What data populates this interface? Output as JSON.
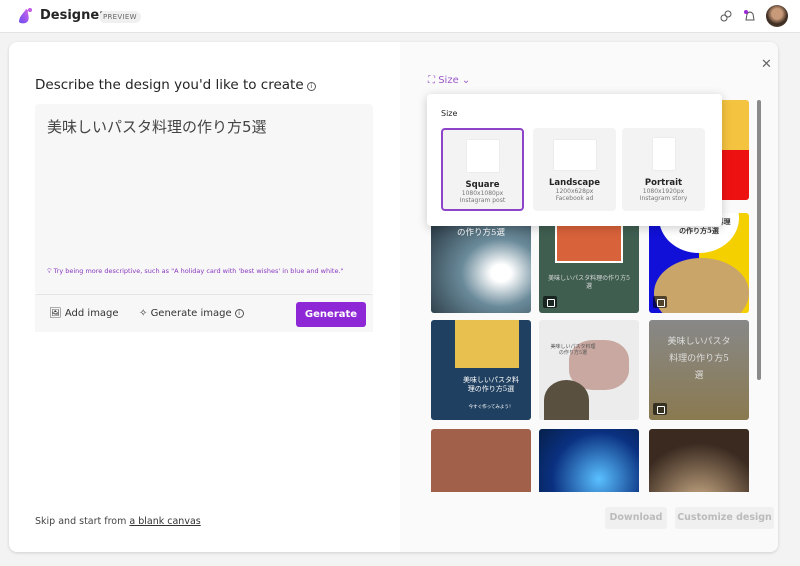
{
  "header": {
    "app_name": "Designer",
    "badge": "PREVIEW"
  },
  "left": {
    "title": "Describe the design you'd like to create",
    "prompt_value": "美味しいパスタ料理の作り方5選",
    "tip": "Try being more descriptive, such as \"A holiday card with 'best wishes' in blue and white.\"",
    "add_image": "Add image",
    "generate_image": "Generate image",
    "generate": "Generate",
    "skip_prefix": "Skip and start from ",
    "skip_link": "a blank canvas"
  },
  "right": {
    "size_label": "Size",
    "download": "Download",
    "customize": "Customize design",
    "tiles": [
      {
        "text": ""
      },
      {
        "text": ""
      },
      {
        "text": "美味しいパスタ\n料理の作り方5選"
      },
      {
        "text": "美味しいパスタ料理\nの作り方5選"
      },
      {
        "text": "美味しいパスタ料理の作り方5\n選"
      },
      {
        "text": "美味しいパスタ料理\nの作り方5選"
      },
      {
        "text": "美味しいパスタ料\n理の作り方5選",
        "sub": "今すぐ作ってみよう！"
      },
      {
        "text": "美味しいパスタ料理\nの作り方5選"
      },
      {
        "text": "美味しいパスタ\n料理の作り方5\n選"
      },
      {
        "text": ""
      },
      {
        "text": ""
      },
      {
        "text": ""
      }
    ]
  },
  "size_popover": {
    "heading": "Size",
    "options": [
      {
        "name": "Square",
        "dims": "1080x1080px",
        "use": "Instagram post"
      },
      {
        "name": "Landscape",
        "dims": "1200x628px",
        "use": "Facebook ad"
      },
      {
        "name": "Portrait",
        "dims": "1080x1920px",
        "use": "Instagram story"
      }
    ]
  },
  "colors": {
    "accent": "#8e27d6"
  }
}
